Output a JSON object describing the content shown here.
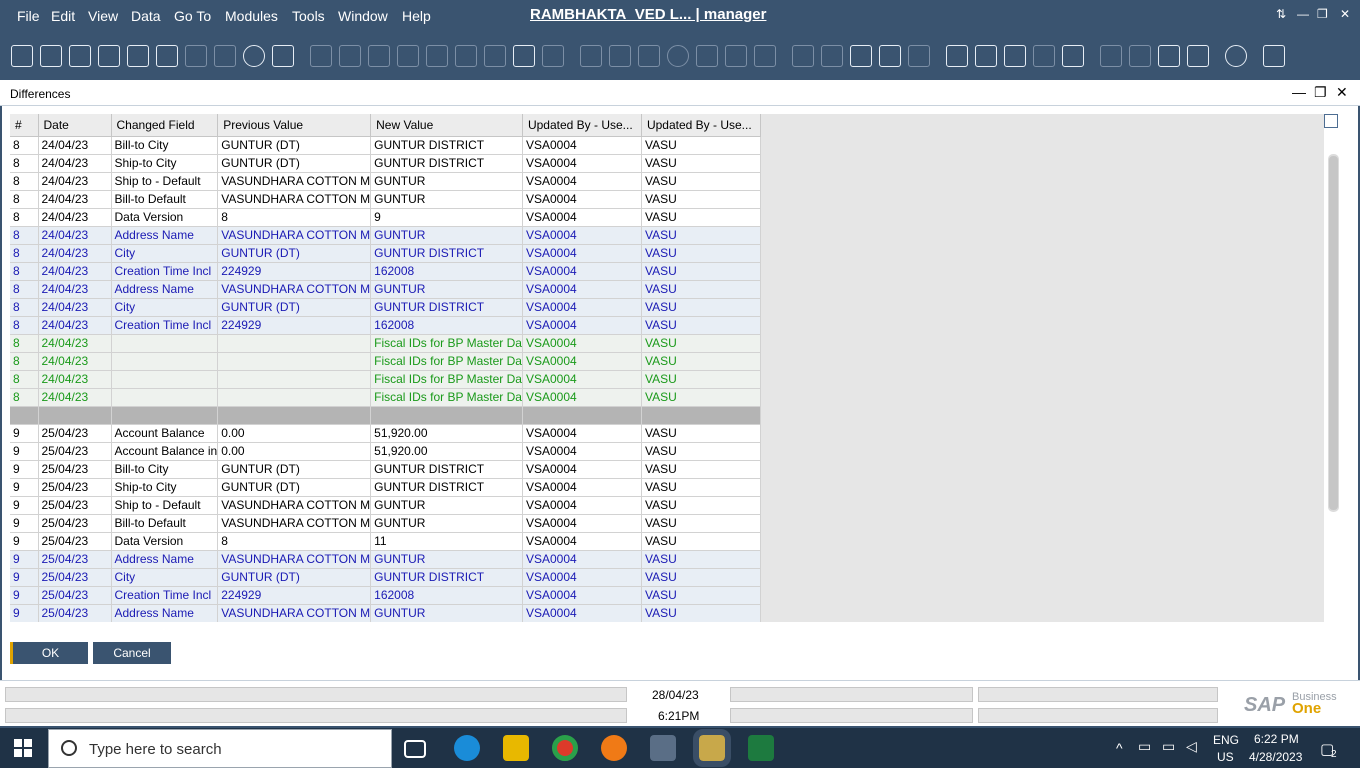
{
  "menu": {
    "items": [
      "File",
      "Edit",
      "View",
      "Data",
      "Go To",
      "Modules",
      "Tools",
      "Window",
      "Help"
    ],
    "title": "RAMBHAKTA_VED L... | manager"
  },
  "dialog": {
    "title": "Differences"
  },
  "grid": {
    "columns": [
      "#",
      "Date",
      "Changed Field",
      "Previous Value",
      "New Value",
      "Updated By - Use...",
      "Updated By - Use..."
    ],
    "rows": [
      {
        "style": "normal",
        "cells": [
          "8",
          "24/04/23",
          "Bill-to City",
          "GUNTUR (DT)",
          "GUNTUR DISTRICT",
          "VSA0004",
          "VASU"
        ]
      },
      {
        "style": "normal",
        "cells": [
          "8",
          "24/04/23",
          "Ship-to City",
          "GUNTUR (DT)",
          "GUNTUR DISTRICT",
          "VSA0004",
          "VASU"
        ]
      },
      {
        "style": "normal",
        "cells": [
          "8",
          "24/04/23",
          "Ship to - Default",
          "VASUNDHARA COTTON M",
          "GUNTUR",
          "VSA0004",
          "VASU"
        ]
      },
      {
        "style": "normal",
        "cells": [
          "8",
          "24/04/23",
          "Bill-to Default",
          "VASUNDHARA COTTON M",
          "GUNTUR",
          "VSA0004",
          "VASU"
        ]
      },
      {
        "style": "normal",
        "cells": [
          "8",
          "24/04/23",
          "Data Version",
          "8",
          "9",
          "VSA0004",
          "VASU"
        ]
      },
      {
        "style": "blue",
        "cells": [
          "8",
          "24/04/23",
          "Address Name",
          "VASUNDHARA COTTON M",
          "GUNTUR",
          "VSA0004",
          "VASU"
        ]
      },
      {
        "style": "blue",
        "cells": [
          "8",
          "24/04/23",
          "City",
          "GUNTUR (DT)",
          "GUNTUR DISTRICT",
          "VSA0004",
          "VASU"
        ]
      },
      {
        "style": "blue",
        "cells": [
          "8",
          "24/04/23",
          "Creation Time Incl",
          "224929",
          "162008",
          "VSA0004",
          "VASU"
        ]
      },
      {
        "style": "blue",
        "cells": [
          "8",
          "24/04/23",
          "Address Name",
          "VASUNDHARA COTTON M",
          "GUNTUR",
          "VSA0004",
          "VASU"
        ]
      },
      {
        "style": "blue",
        "cells": [
          "8",
          "24/04/23",
          "City",
          "GUNTUR (DT)",
          "GUNTUR DISTRICT",
          "VSA0004",
          "VASU"
        ]
      },
      {
        "style": "blue",
        "cells": [
          "8",
          "24/04/23",
          "Creation Time Incl",
          "224929",
          "162008",
          "VSA0004",
          "VASU"
        ]
      },
      {
        "style": "green",
        "cells": [
          "8",
          "24/04/23",
          "",
          "",
          "Fiscal IDs for BP Master Da",
          "VSA0004",
          "VASU"
        ]
      },
      {
        "style": "green",
        "cells": [
          "8",
          "24/04/23",
          "",
          "",
          "Fiscal IDs for BP Master Da",
          "VSA0004",
          "VASU"
        ]
      },
      {
        "style": "green",
        "cells": [
          "8",
          "24/04/23",
          "",
          "",
          "Fiscal IDs for BP Master Da",
          "VSA0004",
          "VASU"
        ]
      },
      {
        "style": "green",
        "cells": [
          "8",
          "24/04/23",
          "",
          "",
          "Fiscal IDs for BP Master Da",
          "VSA0004",
          "VASU"
        ]
      },
      {
        "style": "sep",
        "cells": [
          "",
          "",
          "",
          "",
          "",
          "",
          ""
        ]
      },
      {
        "style": "normal",
        "cells": [
          "9",
          "25/04/23",
          "Account Balance",
          "0.00",
          "51,920.00",
          "VSA0004",
          "VASU"
        ]
      },
      {
        "style": "normal",
        "cells": [
          "9",
          "25/04/23",
          "Account Balance in",
          "0.00",
          "51,920.00",
          "VSA0004",
          "VASU"
        ]
      },
      {
        "style": "normal",
        "cells": [
          "9",
          "25/04/23",
          "Bill-to City",
          "GUNTUR (DT)",
          "GUNTUR DISTRICT",
          "VSA0004",
          "VASU"
        ]
      },
      {
        "style": "normal",
        "cells": [
          "9",
          "25/04/23",
          "Ship-to City",
          "GUNTUR (DT)",
          "GUNTUR DISTRICT",
          "VSA0004",
          "VASU"
        ]
      },
      {
        "style": "normal",
        "cells": [
          "9",
          "25/04/23",
          "Ship to - Default",
          "VASUNDHARA COTTON M",
          "GUNTUR",
          "VSA0004",
          "VASU"
        ]
      },
      {
        "style": "normal",
        "cells": [
          "9",
          "25/04/23",
          "Bill-to Default",
          "VASUNDHARA COTTON M",
          "GUNTUR",
          "VSA0004",
          "VASU"
        ]
      },
      {
        "style": "normal",
        "cells": [
          "9",
          "25/04/23",
          "Data Version",
          "8",
          "11",
          "VSA0004",
          "VASU"
        ]
      },
      {
        "style": "blue",
        "cells": [
          "9",
          "25/04/23",
          "Address Name",
          "VASUNDHARA COTTON M",
          "GUNTUR",
          "VSA0004",
          "VASU"
        ]
      },
      {
        "style": "blue",
        "cells": [
          "9",
          "25/04/23",
          "City",
          "GUNTUR (DT)",
          "GUNTUR DISTRICT",
          "VSA0004",
          "VASU"
        ]
      },
      {
        "style": "blue",
        "cells": [
          "9",
          "25/04/23",
          "Creation Time Incl",
          "224929",
          "162008",
          "VSA0004",
          "VASU"
        ]
      },
      {
        "style": "blue",
        "cells": [
          "9",
          "25/04/23",
          "Address Name",
          "VASUNDHARA COTTON M",
          "GUNTUR",
          "VSA0004",
          "VASU"
        ]
      }
    ]
  },
  "buttons": {
    "ok": "OK",
    "cancel": "Cancel"
  },
  "status": {
    "date": "28/04/23",
    "time": "6:21PM",
    "logo_sap": "SAP",
    "logo_business": "Business",
    "logo_one": "One"
  },
  "taskbar": {
    "search_placeholder": "Type here to search",
    "lang1": "ENG",
    "lang2": "US",
    "clock_time": "6:22 PM",
    "clock_date": "4/28/2023",
    "notif_count": "2"
  },
  "colors": {
    "frame": "#3a5470",
    "accent": "#e0a300",
    "blue_text": "#1a1ab4",
    "green_text": "#1a9a1a"
  }
}
